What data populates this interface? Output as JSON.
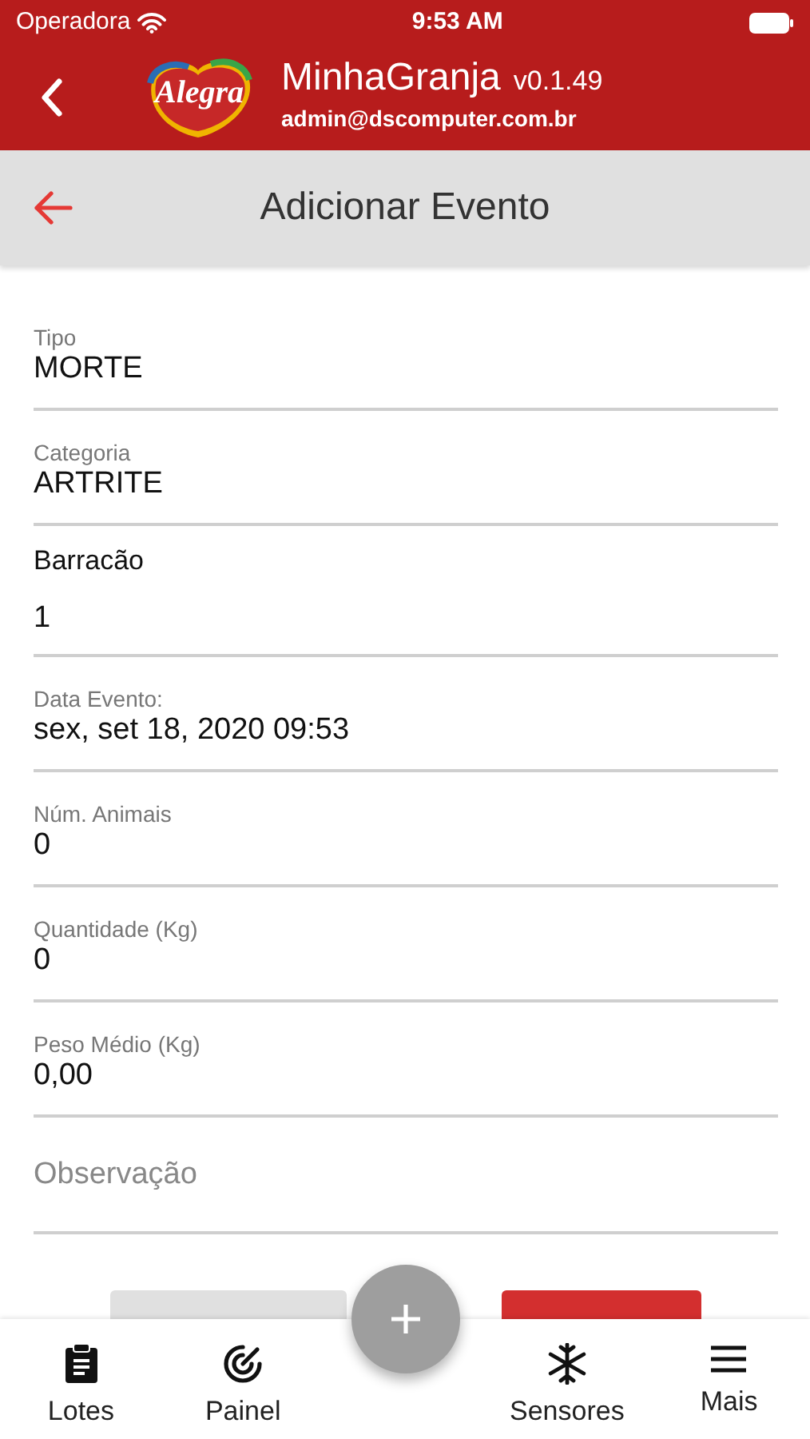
{
  "status_bar": {
    "carrier": "Operadora",
    "time": "9:53 AM"
  },
  "header": {
    "logo_text": "Alegra",
    "app_name": "MinhaGranja",
    "version": "v0.1.49",
    "user": "admin@dscomputer.com.br"
  },
  "page": {
    "title": "Adicionar Evento"
  },
  "fields": [
    {
      "kind": "floating",
      "label": "Tipo",
      "value": "MORTE"
    },
    {
      "kind": "floating",
      "label": "Categoria",
      "value": "ARTRITE"
    },
    {
      "kind": "stacked",
      "label": "Barracão",
      "value": "1"
    },
    {
      "kind": "floating",
      "label": "Data Evento:",
      "value": "sex, set 18, 2020 09:53"
    },
    {
      "kind": "floating",
      "label": "Núm. Animais",
      "value": "0"
    },
    {
      "kind": "floating",
      "label": "Quantidade (Kg)",
      "value": "0"
    },
    {
      "kind": "floating",
      "label": "Peso Médio (Kg)",
      "value": "0,00"
    },
    {
      "kind": "empty",
      "placeholder": "Observação"
    }
  ],
  "actions": [
    {
      "kind": "cancel"
    },
    {
      "kind": "submit"
    }
  ],
  "tabs": [
    {
      "kind": "clipboard",
      "label": "Lotes"
    },
    {
      "kind": "radar",
      "label": "Painel"
    },
    {
      "kind": "fab"
    },
    {
      "kind": "snowflake",
      "label": "Sensores"
    },
    {
      "kind": "menu",
      "label": "Mais"
    }
  ]
}
